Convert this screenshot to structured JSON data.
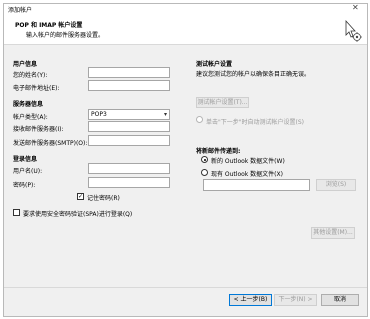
{
  "window": {
    "title": "添加帐户",
    "close_glyph": "✕"
  },
  "header": {
    "title": "POP 和 IMAP 帐户设置",
    "subtitle": "输入帐户的邮件服务器设置。"
  },
  "user_info": {
    "section": "用户信息",
    "name_label": "您的姓名(Y):",
    "name_value": "",
    "email_label": "电子邮件地址(E):",
    "email_value": ""
  },
  "server_info": {
    "section": "服务器信息",
    "account_type_label": "帐户类型(A):",
    "account_type_value": "POP3",
    "incoming_label": "接收邮件服务器(I):",
    "incoming_value": "",
    "outgoing_label": "发送邮件服务器(SMTP)(O):",
    "outgoing_value": ""
  },
  "login_info": {
    "section": "登录信息",
    "username_label": "用户名(U):",
    "username_value": "",
    "password_label": "密码(P):",
    "password_value": "",
    "remember_label": "记住密码(R)",
    "remember_checked": true,
    "spa_label": "要求使用安全密码验证(SPA)进行登录(Q)",
    "spa_checked": false
  },
  "test": {
    "section": "测试帐户设置",
    "description": "建议您测试您的帐户以确保条目正确无误。",
    "test_button": "测试帐户设置(T)...",
    "auto_test_label": "单击\"下一步\"时自动测试帐户设置(S)"
  },
  "delivery": {
    "section": "将新邮件传递到:",
    "new_file_label": "新的 Outlook 数据文件(W)",
    "existing_file_label": "现有 Outlook 数据文件(X)",
    "file_path_value": "",
    "browse_button": "浏览(S)"
  },
  "more_settings_button": "其他设置(M)...",
  "footer": {
    "back": "< 上一步(B)",
    "next": "下一步(N) >",
    "cancel": "取消"
  },
  "colors": {
    "accent": "#0078d7",
    "panel": "#f0f0f0",
    "border": "#a6a6a6"
  }
}
